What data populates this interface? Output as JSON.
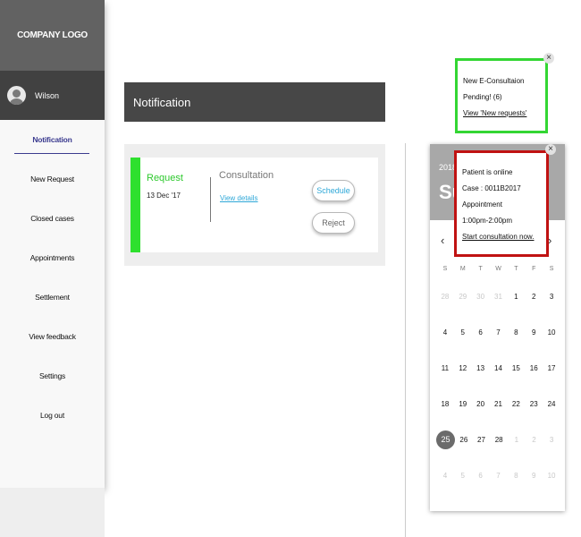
{
  "sidebar": {
    "logo": "COMPANY LOGO",
    "user_name": "Wilson",
    "menu": [
      {
        "label": "Notification",
        "active": true
      },
      {
        "label": "New Request"
      },
      {
        "label": "Closed cases"
      },
      {
        "label": "Appointments"
      },
      {
        "label": "Settlement"
      },
      {
        "label": "View feedback"
      },
      {
        "label": "Settings"
      },
      {
        "label": "Log out"
      }
    ]
  },
  "main": {
    "header_title": "Notification",
    "card": {
      "request_label": "Request",
      "request_date": "13 Dec '17",
      "consultation_label": "Consultation",
      "view_details": "View details",
      "schedule_button": "Schedule",
      "reject_button": "Reject"
    }
  },
  "calendar": {
    "year": "2018",
    "day_label": "Su",
    "prev_icon": "‹",
    "next_icon": "›",
    "weekdays": [
      "S",
      "M",
      "T",
      "W",
      "T",
      "F",
      "S"
    ],
    "weeks": [
      [
        "28",
        "29",
        "30",
        "31",
        "1",
        "2",
        "3"
      ],
      [
        "4",
        "5",
        "6",
        "7",
        "8",
        "9",
        "10"
      ],
      [
        "11",
        "12",
        "13",
        "14",
        "15",
        "16",
        "17"
      ],
      [
        "18",
        "19",
        "20",
        "21",
        "22",
        "23",
        "24"
      ],
      [
        "25",
        "26",
        "27",
        "28",
        "1",
        "2",
        "3"
      ],
      [
        "4",
        "5",
        "6",
        "7",
        "8",
        "9",
        "10"
      ]
    ],
    "selected_day": "25"
  },
  "popups": {
    "new_consultation": {
      "line1": "New E-Consultaion",
      "line2": "Pending! (6)",
      "link": "View 'New requests'",
      "close": "×"
    },
    "patient_online": {
      "line1": "Patient is online",
      "line2": "Case : 0011B2017",
      "line3": "Appointment",
      "line4": "1:00pm-2:00pm",
      "link": "Start consultation now.",
      "close": "×"
    }
  },
  "colors": {
    "accent_green": "#2ee02e",
    "alert_red": "#c01212",
    "link_blue": "#2fa8d8",
    "header_dark": "#474747"
  }
}
